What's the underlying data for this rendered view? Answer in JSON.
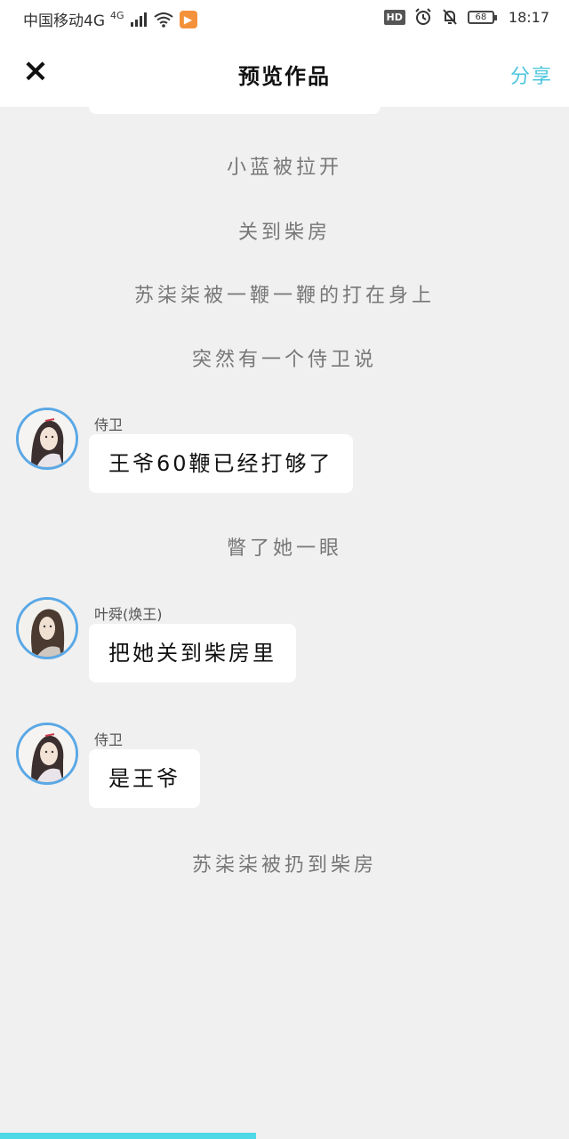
{
  "status_bar": {
    "carrier": "中国移动4G",
    "signal_label": "4G",
    "battery": "68",
    "time": "18:17",
    "hd": "HD"
  },
  "header": {
    "close_icon": "×",
    "title": "预览作品",
    "share_label": "分享"
  },
  "narrations": [
    "小蓝被拉开",
    "关到柴房",
    "苏柒柒被一鞭一鞭的打在身上",
    "突然有一个侍卫说",
    "瞥了她一眼",
    "苏柒柒被扔到柴房"
  ],
  "messages": [
    {
      "sender": "侍卫",
      "text": "王爷60鞭已经打够了"
    },
    {
      "sender": "叶舜(焕王)",
      "text": "把她关到柴房里"
    },
    {
      "sender": "侍卫",
      "text": "是王爷"
    }
  ],
  "progress": {
    "fraction": 0.45
  },
  "colors": {
    "accent": "#4ec5dc",
    "avatar_ring": "#5aa8e6",
    "progress": "#4fd8e6",
    "background": "#f0f0f0"
  }
}
